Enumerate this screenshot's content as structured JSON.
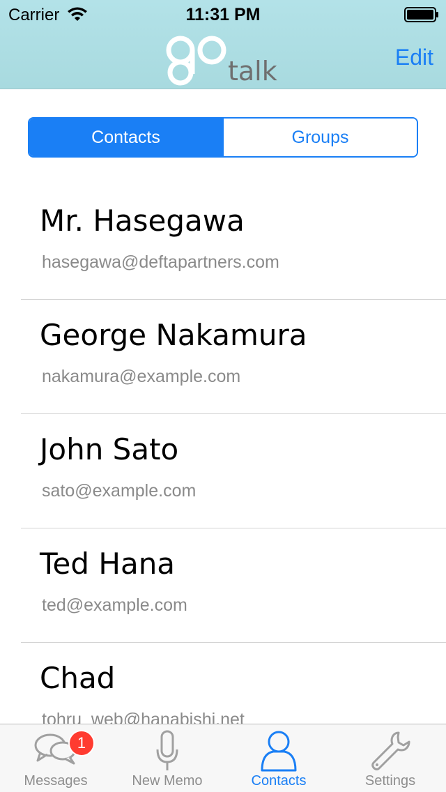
{
  "status_bar": {
    "carrier": "Carrier",
    "time": "11:31 PM"
  },
  "nav": {
    "logo_icon": "go-logo-icon",
    "logo_text": "talk",
    "edit_label": "Edit"
  },
  "segments": {
    "contacts_label": "Contacts",
    "groups_label": "Groups",
    "selected": "Contacts"
  },
  "contacts": [
    {
      "name": "Mr. Hasegawa",
      "email": "hasegawa@deftapartners.com"
    },
    {
      "name": "George Nakamura",
      "email": "nakamura@example.com"
    },
    {
      "name": "John Sato",
      "email": "sato@example.com"
    },
    {
      "name": "Ted Hana",
      "email": "ted@example.com"
    },
    {
      "name": "Chad",
      "email": "tohru_web@hanabishi.net"
    }
  ],
  "tab_bar": {
    "messages_label": "Messages",
    "messages_badge": "1",
    "new_memo_label": "New Memo",
    "contacts_label": "Contacts",
    "settings_label": "Settings",
    "active": "Contacts"
  },
  "colors": {
    "accent": "#1a7ff5",
    "header_bg": "#aedde2",
    "badge": "#ff3b30"
  }
}
